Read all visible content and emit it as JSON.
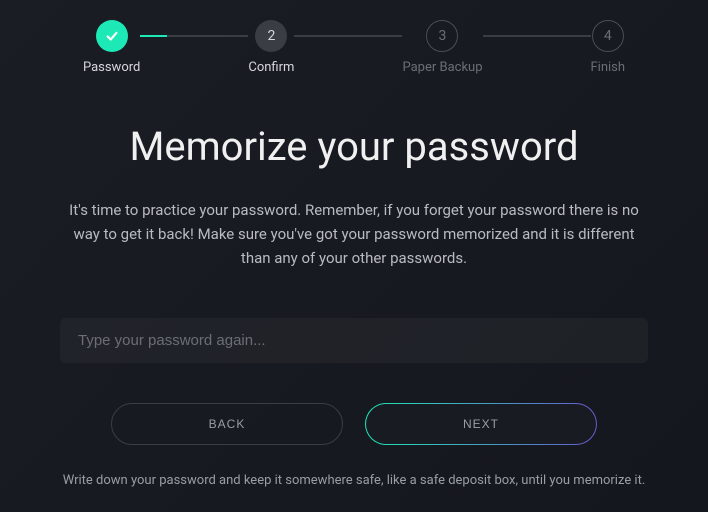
{
  "stepper": {
    "steps": [
      {
        "num": "✓",
        "label": "Password",
        "state": "done"
      },
      {
        "num": "2",
        "label": "Confirm",
        "state": "current"
      },
      {
        "num": "3",
        "label": "Paper Backup",
        "state": "pending"
      },
      {
        "num": "4",
        "label": "Finish",
        "state": "pending"
      }
    ]
  },
  "main": {
    "title": "Memorize your password",
    "description": "It's time to practice your password. Remember, if you forget your password there is no way to get it back! Make sure you've got your password memorized and it is different than any of your other passwords.",
    "input_placeholder": "Type your password again...",
    "back_label": "BACK",
    "next_label": "NEXT",
    "footer_note": "Write down your password and keep it somewhere safe, like a safe deposit box, until you memorize it."
  },
  "colors": {
    "accent": "#1de9b6"
  }
}
